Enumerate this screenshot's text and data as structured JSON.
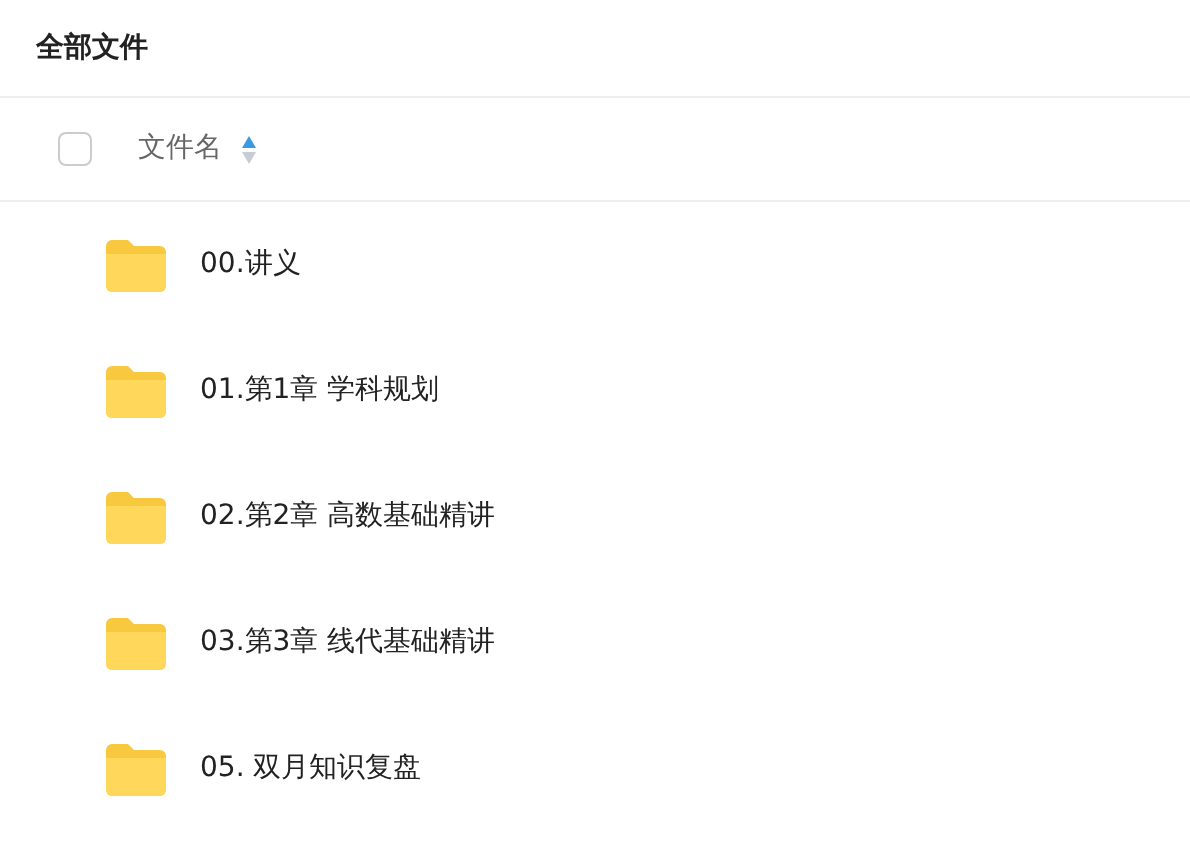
{
  "title": "全部文件",
  "header": {
    "checked": false,
    "label": "文件名",
    "sort_ascending": true
  },
  "files": [
    {
      "name": "00.讲义"
    },
    {
      "name": "01.第1章 学科规划"
    },
    {
      "name": "02.第2章 高数基础精讲"
    },
    {
      "name": "03.第3章 线代基础精讲"
    },
    {
      "name": "05. 双月知识复盘"
    }
  ]
}
